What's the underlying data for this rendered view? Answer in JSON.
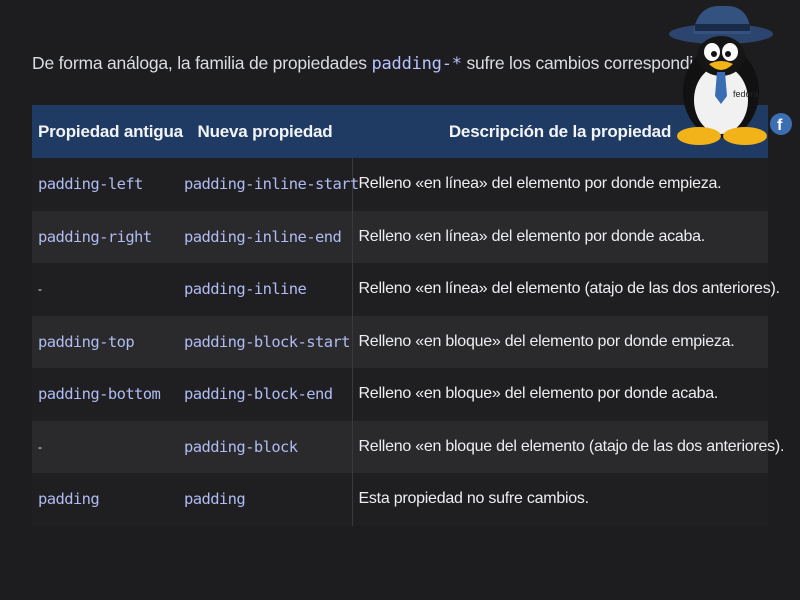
{
  "intro": {
    "before": "De forma análoga, la familia de propiedades ",
    "code": "padding-*",
    "after": " sufre los cambios correspondientes:"
  },
  "table": {
    "headers": [
      "Propiedad antigua",
      "Nueva propiedad",
      "Descripción de la propiedad"
    ],
    "rows": [
      {
        "old": "padding-left",
        "new": "padding-inline-start",
        "desc": "Relleno «en línea» del elemento por donde empieza."
      },
      {
        "old": "padding-right",
        "new": "padding-inline-end",
        "desc": "Relleno «en línea» del elemento por donde acaba."
      },
      {
        "old": "-",
        "new": "padding-inline",
        "desc": "Relleno «en línea» del elemento (atajo de las dos anteriores)."
      },
      {
        "old": "padding-top",
        "new": "padding-block-start",
        "desc": "Relleno «en bloque» del elemento por donde empieza."
      },
      {
        "old": "padding-bottom",
        "new": "padding-block-end",
        "desc": "Relleno «en bloque» del elemento por donde acaba."
      },
      {
        "old": "-",
        "new": "padding-block",
        "desc": "Relleno «en bloque del elemento (atajo de las dos anteriores)."
      },
      {
        "old": "padding",
        "new": "padding",
        "desc": "Esta propiedad no sufre cambios."
      }
    ]
  },
  "mascot": {
    "icon": "tux-fedora-penguin-icon",
    "hat_text": "fedora",
    "badge_icon": "fedora-logo-icon"
  },
  "colors": {
    "background": "#1d1d1f",
    "header": "#1f3b63",
    "code_text": "#b0bbf2"
  }
}
